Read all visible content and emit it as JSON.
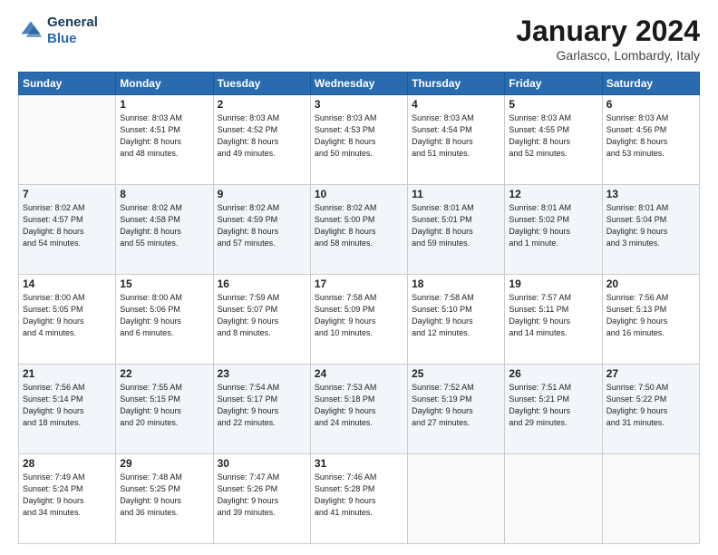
{
  "header": {
    "logo_general": "General",
    "logo_blue": "Blue",
    "month": "January 2024",
    "location": "Garlasco, Lombardy, Italy"
  },
  "weekdays": [
    "Sunday",
    "Monday",
    "Tuesday",
    "Wednesday",
    "Thursday",
    "Friday",
    "Saturday"
  ],
  "weeks": [
    [
      {
        "day": "",
        "info": ""
      },
      {
        "day": "1",
        "info": "Sunrise: 8:03 AM\nSunset: 4:51 PM\nDaylight: 8 hours\nand 48 minutes."
      },
      {
        "day": "2",
        "info": "Sunrise: 8:03 AM\nSunset: 4:52 PM\nDaylight: 8 hours\nand 49 minutes."
      },
      {
        "day": "3",
        "info": "Sunrise: 8:03 AM\nSunset: 4:53 PM\nDaylight: 8 hours\nand 50 minutes."
      },
      {
        "day": "4",
        "info": "Sunrise: 8:03 AM\nSunset: 4:54 PM\nDaylight: 8 hours\nand 51 minutes."
      },
      {
        "day": "5",
        "info": "Sunrise: 8:03 AM\nSunset: 4:55 PM\nDaylight: 8 hours\nand 52 minutes."
      },
      {
        "day": "6",
        "info": "Sunrise: 8:03 AM\nSunset: 4:56 PM\nDaylight: 8 hours\nand 53 minutes."
      }
    ],
    [
      {
        "day": "7",
        "info": "Sunrise: 8:02 AM\nSunset: 4:57 PM\nDaylight: 8 hours\nand 54 minutes."
      },
      {
        "day": "8",
        "info": "Sunrise: 8:02 AM\nSunset: 4:58 PM\nDaylight: 8 hours\nand 55 minutes."
      },
      {
        "day": "9",
        "info": "Sunrise: 8:02 AM\nSunset: 4:59 PM\nDaylight: 8 hours\nand 57 minutes."
      },
      {
        "day": "10",
        "info": "Sunrise: 8:02 AM\nSunset: 5:00 PM\nDaylight: 8 hours\nand 58 minutes."
      },
      {
        "day": "11",
        "info": "Sunrise: 8:01 AM\nSunset: 5:01 PM\nDaylight: 8 hours\nand 59 minutes."
      },
      {
        "day": "12",
        "info": "Sunrise: 8:01 AM\nSunset: 5:02 PM\nDaylight: 9 hours\nand 1 minute."
      },
      {
        "day": "13",
        "info": "Sunrise: 8:01 AM\nSunset: 5:04 PM\nDaylight: 9 hours\nand 3 minutes."
      }
    ],
    [
      {
        "day": "14",
        "info": "Sunrise: 8:00 AM\nSunset: 5:05 PM\nDaylight: 9 hours\nand 4 minutes."
      },
      {
        "day": "15",
        "info": "Sunrise: 8:00 AM\nSunset: 5:06 PM\nDaylight: 9 hours\nand 6 minutes."
      },
      {
        "day": "16",
        "info": "Sunrise: 7:59 AM\nSunset: 5:07 PM\nDaylight: 9 hours\nand 8 minutes."
      },
      {
        "day": "17",
        "info": "Sunrise: 7:58 AM\nSunset: 5:09 PM\nDaylight: 9 hours\nand 10 minutes."
      },
      {
        "day": "18",
        "info": "Sunrise: 7:58 AM\nSunset: 5:10 PM\nDaylight: 9 hours\nand 12 minutes."
      },
      {
        "day": "19",
        "info": "Sunrise: 7:57 AM\nSunset: 5:11 PM\nDaylight: 9 hours\nand 14 minutes."
      },
      {
        "day": "20",
        "info": "Sunrise: 7:56 AM\nSunset: 5:13 PM\nDaylight: 9 hours\nand 16 minutes."
      }
    ],
    [
      {
        "day": "21",
        "info": "Sunrise: 7:56 AM\nSunset: 5:14 PM\nDaylight: 9 hours\nand 18 minutes."
      },
      {
        "day": "22",
        "info": "Sunrise: 7:55 AM\nSunset: 5:15 PM\nDaylight: 9 hours\nand 20 minutes."
      },
      {
        "day": "23",
        "info": "Sunrise: 7:54 AM\nSunset: 5:17 PM\nDaylight: 9 hours\nand 22 minutes."
      },
      {
        "day": "24",
        "info": "Sunrise: 7:53 AM\nSunset: 5:18 PM\nDaylight: 9 hours\nand 24 minutes."
      },
      {
        "day": "25",
        "info": "Sunrise: 7:52 AM\nSunset: 5:19 PM\nDaylight: 9 hours\nand 27 minutes."
      },
      {
        "day": "26",
        "info": "Sunrise: 7:51 AM\nSunset: 5:21 PM\nDaylight: 9 hours\nand 29 minutes."
      },
      {
        "day": "27",
        "info": "Sunrise: 7:50 AM\nSunset: 5:22 PM\nDaylight: 9 hours\nand 31 minutes."
      }
    ],
    [
      {
        "day": "28",
        "info": "Sunrise: 7:49 AM\nSunset: 5:24 PM\nDaylight: 9 hours\nand 34 minutes."
      },
      {
        "day": "29",
        "info": "Sunrise: 7:48 AM\nSunset: 5:25 PM\nDaylight: 9 hours\nand 36 minutes."
      },
      {
        "day": "30",
        "info": "Sunrise: 7:47 AM\nSunset: 5:26 PM\nDaylight: 9 hours\nand 39 minutes."
      },
      {
        "day": "31",
        "info": "Sunrise: 7:46 AM\nSunset: 5:28 PM\nDaylight: 9 hours\nand 41 minutes."
      },
      {
        "day": "",
        "info": ""
      },
      {
        "day": "",
        "info": ""
      },
      {
        "day": "",
        "info": ""
      }
    ]
  ]
}
